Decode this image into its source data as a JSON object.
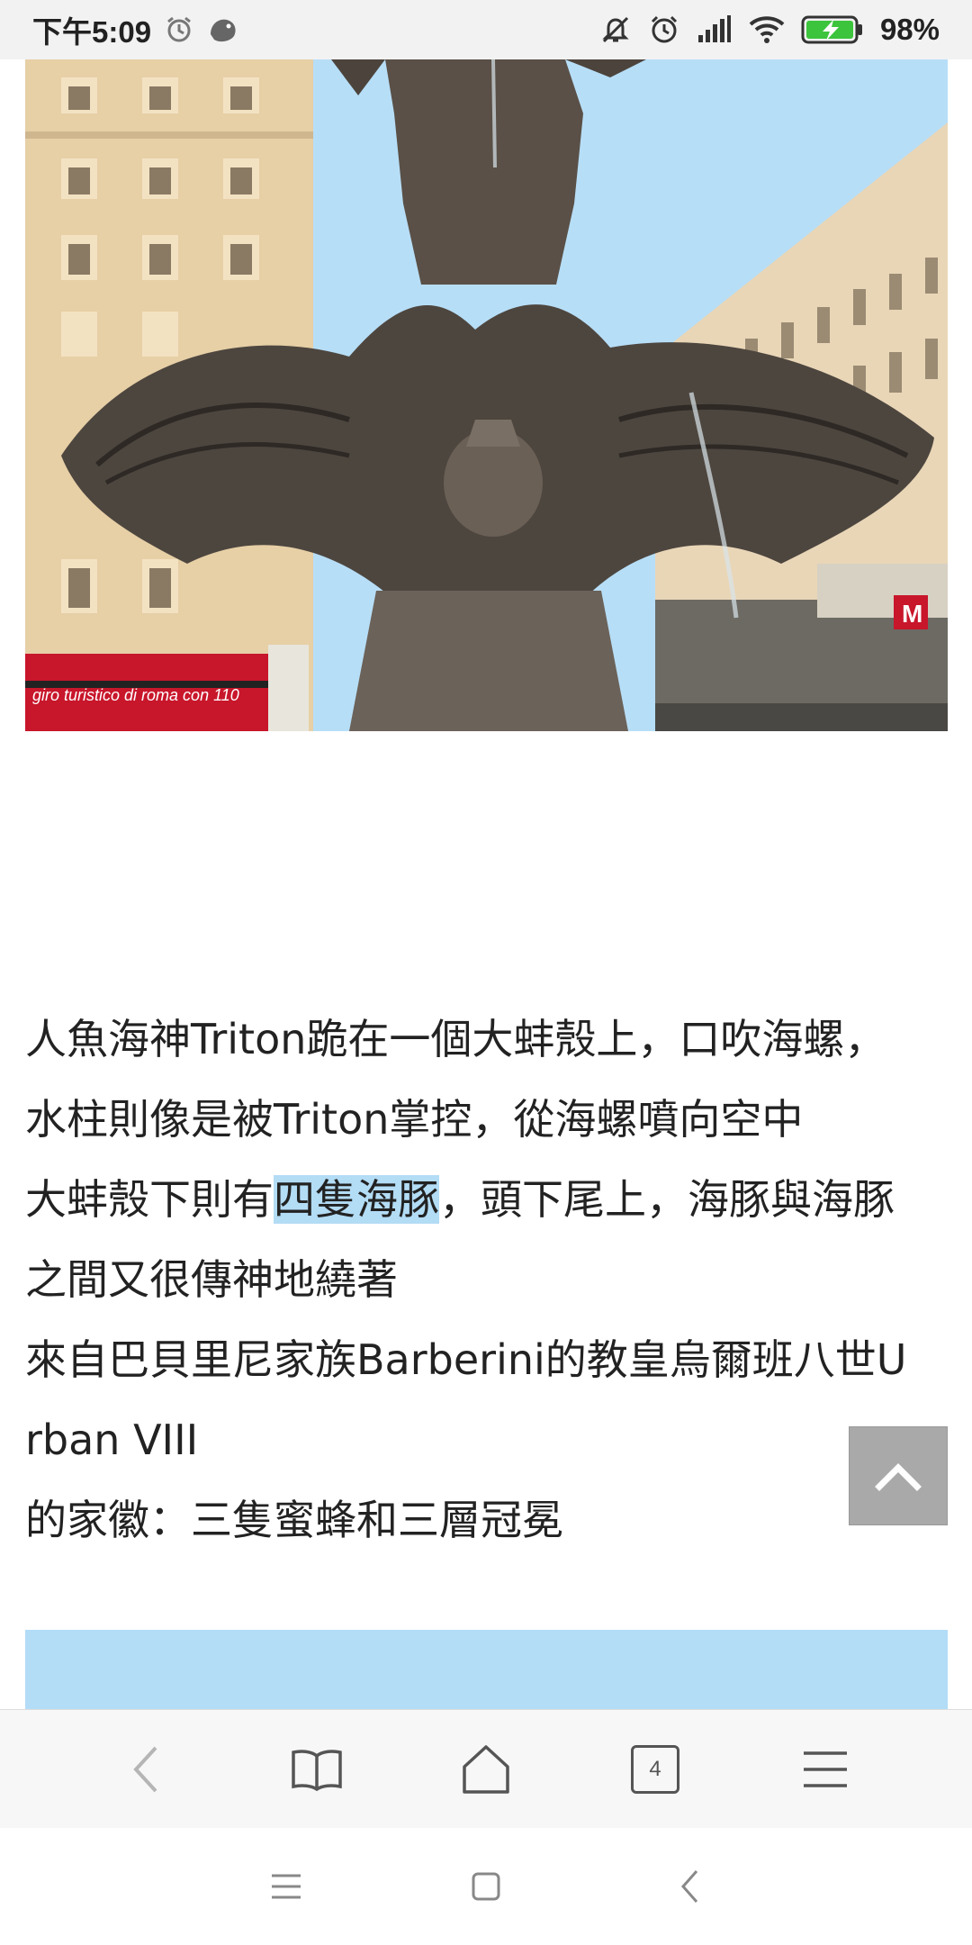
{
  "status_bar": {
    "time": "下午5:09",
    "battery_percent": "98%",
    "icons": [
      "alarm-icon",
      "app-notification-icon",
      "mute-icon",
      "alarm-icon",
      "signal-icon",
      "wifi-icon",
      "battery-charging-icon"
    ]
  },
  "article": {
    "lines": [
      "人魚海神Triton跪在一個大蚌殼上，口吹海螺，",
      "水柱則像是被Triton掌控，從海螺噴向空中",
      "大蚌殼下則有",
      "四隻海豚",
      "，頭下尾上，海豚與海豚",
      "之間又很傳神地繞著",
      "來自巴貝里尼家族Barberini的教皇烏爾班八世U",
      "rban VIII",
      "的家徽：三隻蜜蜂和三層冠冕"
    ],
    "highlighted_text": "四隻海豚"
  },
  "photo_caption_texts": {
    "bus_text": "giro turistico di roma con 110",
    "metro_sign": "M"
  },
  "browser_toolbar": {
    "tab_count": "4",
    "buttons": [
      "back-icon",
      "bookmarks-icon",
      "home-icon",
      "tabs-icon",
      "menu-icon"
    ]
  },
  "system_nav": {
    "buttons": [
      "recent-apps-icon",
      "home-icon",
      "back-icon"
    ]
  },
  "colors": {
    "highlight": "#b3dcf5",
    "status_bar_bg": "#f2f2f2",
    "battery_green": "#3cc43c",
    "back_top_bg": "#a9a9a9"
  }
}
